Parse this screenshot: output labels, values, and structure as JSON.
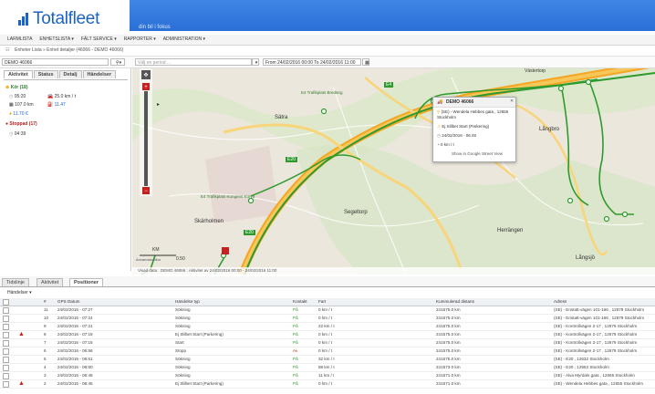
{
  "header": {
    "logo": "Totalfleet",
    "tagline": "din bil i fokus"
  },
  "menu": [
    "LARMLISTA",
    "ENHETSLISTA ▾",
    "FÄLT SERVICE ▾",
    "RAPPORTER ▾",
    "ADMINISTRATION ▾"
  ],
  "breadcrumb": "Enheter Lista » Enhet detaljer (46066 - DEMO 46066)",
  "vehicle": {
    "value": "DEMO 46066",
    "period_placeholder": "Välj en period ...",
    "range": "From 24/02/2016 00:00 To 24/02/2016 11:00"
  },
  "left_tabs": [
    "Aktivitet",
    "Status",
    "Detalj",
    "Händelser"
  ],
  "activity": {
    "run_label": "Kör (18)",
    "time1": "05:20",
    "speed": "25.0 km / t",
    "dist": "107.0 km",
    "fuel1": "11.47",
    "fuel2": "11.70 €",
    "stop_label": "Stoppad (17)",
    "time2": "04:39"
  },
  "popup": {
    "title": "DEMO 46066",
    "address": "(SE) - Wendela Hebbes gata , 12655 Stockholm",
    "event": "Ej Slilbet Start (Parkering)",
    "time": "24/02/2016 - 06:45",
    "speed": "0 km / t",
    "link": "Show in Google Street View"
  },
  "map_labels": {
    "satra": "Sätra",
    "skarholmen": "Skärholmen",
    "segeltorp": "Segeltorp",
    "herrangen": "Herrängen",
    "langbro": "Långbro",
    "langsjo": "Långsjö",
    "vasterorp": "Västertorp",
    "e20": "E20",
    "e4": "E4",
    "road1": "E4 Trafikplats Bredäng",
    "road2": "E4 Trafikplats Kungens Kurva",
    "scale": "KM",
    "scale_val": "0.50",
    "copyright": "Anvandarvillkor"
  },
  "map_info": "Visad data : DEMO 46066 : Aktivitet av 24/02/2016 00:00 - 24/02/2016 11:00",
  "bottom_tabs": [
    "Tidslinje",
    "Aktivitet",
    "Positioner"
  ],
  "filter": "Händelser ▾",
  "columns": [
    "#",
    "GPS Datum",
    "Händelse typ",
    "Kontakt",
    "Fart",
    "Kummulerad distans",
    "Adress"
  ],
  "rows": [
    [
      "11",
      "24/02/2016 - 07:27",
      "Sökning",
      "På",
      "0 km / t",
      "241575.0 km",
      "(SE) - Enstatt-vägen 101-166 , 12679 Stockholm"
    ],
    [
      "10",
      "24/02/2016 - 07:24",
      "Sökning",
      "På",
      "0 km / t",
      "241575.0 km",
      "(SE) - Enstatt-vägen 101-166 , 12679 Stockholm"
    ],
    [
      "9",
      "24/02/2016 - 07:21",
      "Sökning",
      "På",
      "22 km / t",
      "241575.0 km",
      "(SE) - Kontrollvägen 2-17 , 12679 Stockholm"
    ],
    [
      "8",
      "24/02/2016 - 07:18",
      "Ej Slilbet Start (Parkering)",
      "På",
      "0 km / t",
      "241575.0 km",
      "(SE) - Kontrollvägen 2-17 , 12679 Stockholm"
    ],
    [
      "7",
      "24/02/2016 - 07:16",
      "Start",
      "På",
      "0 km / t",
      "241575.0 km",
      "(SE) - Kontrollvägen 2-17 , 12679 Stockholm"
    ],
    [
      "6",
      "24/02/2016 - 06:56",
      "Stopp",
      "Av",
      "0 km / t",
      "241575.0 km",
      "(SE) - Kontrollvägen 2-17 , 12679 Stockholm"
    ],
    [
      "5",
      "24/02/2016 - 06:51",
      "Sökning",
      "På",
      "32 km / t",
      "241575.0 km",
      "(SE) - E20 , 12632 Stockholm"
    ],
    [
      "4",
      "24/02/2016 - 06:50",
      "Sökning",
      "På",
      "88 km / t",
      "241573.0 km",
      "(SE) - E20 , 12952 Stockholm"
    ],
    [
      "3",
      "24/02/2016 - 06:48",
      "Sökning",
      "På",
      "11 km / t",
      "241571.0 km",
      "(SE) - Alva Myrdals gata , 12655 Stockholm"
    ],
    [
      "2",
      "24/02/2016 - 06:45",
      "Ej Slilbet Start (Parkering)",
      "På",
      "0 km / t",
      "241571.0 km",
      "(SE) - Wendela Hebbes gata , 12655 Stockholm"
    ]
  ],
  "warning_rows": [
    3,
    9
  ],
  "colors": {
    "brand": "#1b63c4",
    "route": "#2e9a2e",
    "alert": "#c62020"
  }
}
